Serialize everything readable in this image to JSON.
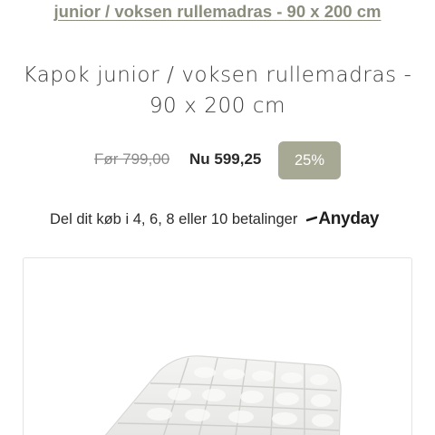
{
  "breadcrumb": {
    "current_link": "junior / voksen rullemadras - 90 x 200 cm"
  },
  "product": {
    "title_line1": "Kapok junior / voksen rullemadras -",
    "title_line2": "90 x 200 cm",
    "old_price": "Før 799,00",
    "new_price": "Nu 599,25",
    "discount": "25%",
    "installments_text": "Del dit køb i 4, 6, 8 eller 10 betalinger",
    "payment_provider": "Anyday",
    "image_icon": "quilted-mattress-image"
  },
  "colors": {
    "accent": "#a8a995",
    "link": "#8b8d7c"
  }
}
